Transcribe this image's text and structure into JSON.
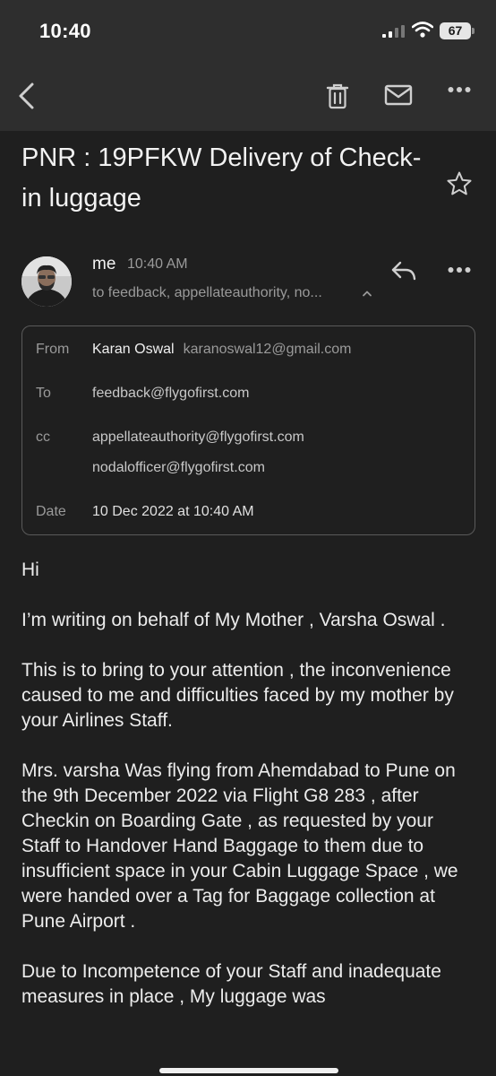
{
  "status_bar": {
    "time": "10:40",
    "battery": "67"
  },
  "email": {
    "subject": "PNR : 19PFKW Delivery of Check-in luggage",
    "sender": {
      "short_name": "me",
      "time": "10:40 AM",
      "recipients_summary": "to feedback, appellateauthority, no..."
    },
    "details": {
      "from_label": "From",
      "from_name": "Karan Oswal",
      "from_email": "karanoswal12@gmail.com",
      "to_label": "To",
      "to_value": "feedback@flygofirst.com",
      "cc_label": "cc",
      "cc_values": [
        "appellateauthority@flygofirst.com",
        "nodalofficer@flygofirst.com"
      ],
      "date_label": "Date",
      "date_value": "10 Dec 2022 at 10:40 AM"
    },
    "body": [
      "Hi",
      "I’m writing on behalf of My Mother , Varsha Oswal .",
      "This is to bring to your attention , the inconvenience caused to me and difficulties faced by my mother by your Airlines Staff.",
      "Mrs. varsha Was flying from Ahemdabad to Pune on the 9th December 2022 via Flight G8 283 , after Checkin on Boarding Gate , as requested by your Staff to Handover Hand Baggage to them due to insufficient space in your Cabin Luggage Space , we were handed over a Tag for Baggage collection at Pune Airport .",
      "Due to Incompetence of your Staff and inadequate measures in place , My luggage was"
    ]
  },
  "icons": {
    "back": "back-chevron-icon",
    "delete": "trash-icon",
    "mark_unread": "mail-icon",
    "more": "more-horizontal-icon",
    "star": "star-outline-icon",
    "reply": "reply-icon",
    "expand": "chevron-up-icon"
  }
}
